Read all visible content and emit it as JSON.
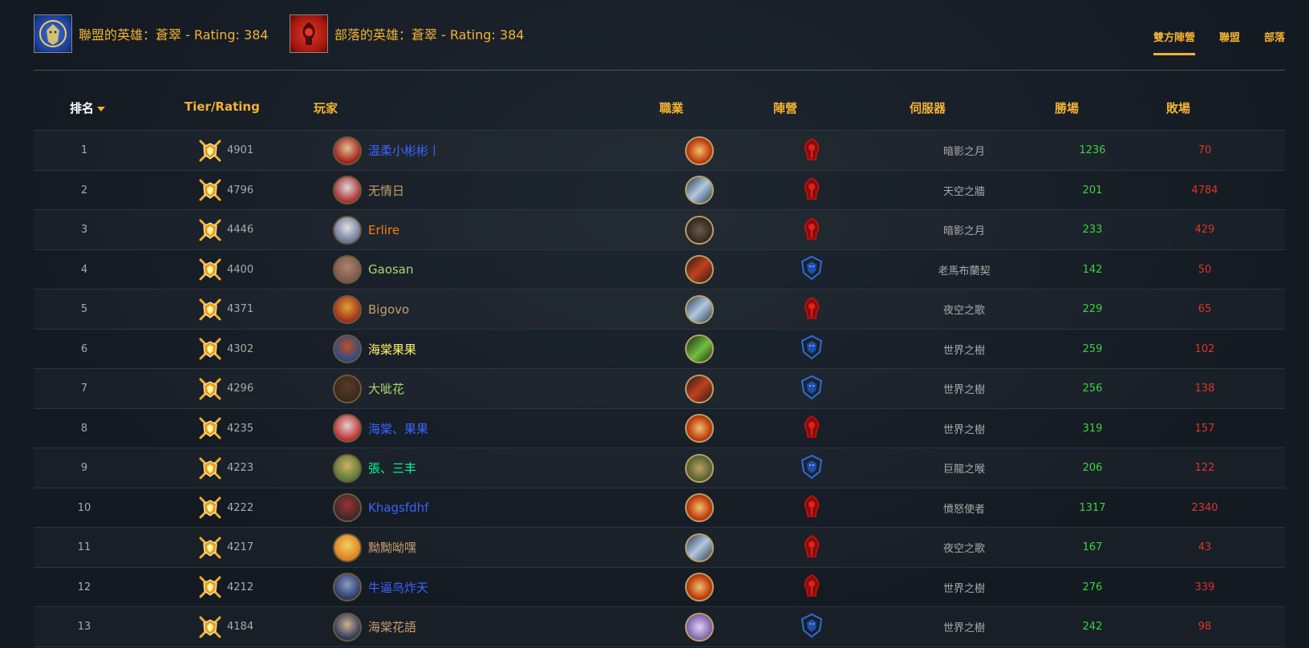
{
  "header": {
    "alliance_hero": "聯盟的英雄：蒼翠 - Rating: 384",
    "horde_hero": "部落的英雄：蒼翠 - Rating: 384",
    "tabs": [
      {
        "label": "雙方陣營",
        "active": true
      },
      {
        "label": "聯盟",
        "active": false
      },
      {
        "label": "部落",
        "active": false
      }
    ]
  },
  "columns": {
    "rank": "排名",
    "tier": "Tier/Rating",
    "player": "玩家",
    "class": "職業",
    "faction": "陣營",
    "server": "伺服器",
    "wins": "勝場",
    "losses": "敗場"
  },
  "colors": {
    "accent": "#f2b233",
    "wins": "#3fd13f",
    "losses": "#d9362a",
    "horde": "#c8120f",
    "alliance": "#2a6fd8"
  },
  "rows": [
    {
      "rank": "1",
      "rating": "4901",
      "name": "温柔小彬彬丨",
      "name_color": "#3a63ff",
      "avatar": [
        "#a02020",
        "#e0c090"
      ],
      "class": "paladin",
      "faction": "horde",
      "server": "暗影之月",
      "wins": "1236",
      "losses": "70"
    },
    {
      "rank": "2",
      "rating": "4796",
      "name": "无情日",
      "name_color": "#c79c6e",
      "avatar": [
        "#b03030",
        "#d8d8d8"
      ],
      "class": "warrior",
      "faction": "horde",
      "server": "天空之牆",
      "wins": "201",
      "losses": "4784"
    },
    {
      "rank": "3",
      "rating": "4446",
      "name": "Erlire",
      "name_color": "#ff7d0a",
      "avatar": [
        "#6a7a9a",
        "#e0e0e0"
      ],
      "class": "rogue",
      "faction": "horde",
      "server": "暗影之月",
      "wins": "233",
      "losses": "429"
    },
    {
      "rank": "4",
      "rating": "4400",
      "name": "Gaosan",
      "name_color": "#abd473",
      "avatar": [
        "#7a5a4a",
        "#b08070"
      ],
      "class": "hunter",
      "faction": "alliance",
      "server": "老馬布蘭契",
      "wins": "142",
      "losses": "50"
    },
    {
      "rank": "5",
      "rating": "4371",
      "name": "Bigovo",
      "name_color": "#c79c6e",
      "avatar": [
        "#a03020",
        "#e0a030"
      ],
      "class": "warrior",
      "faction": "horde",
      "server": "夜空之歌",
      "wins": "229",
      "losses": "65"
    },
    {
      "rank": "6",
      "rating": "4302",
      "name": "海棠果果",
      "name_color": "#fff569",
      "avatar": [
        "#2a4a8a",
        "#c05020"
      ],
      "class": "druid",
      "faction": "alliance",
      "server": "世界之樹",
      "wins": "259",
      "losses": "102"
    },
    {
      "rank": "7",
      "rating": "4296",
      "name": "大呲花",
      "name_color": "#abd473",
      "avatar": [
        "#3a2a1a",
        "#5a3a2a"
      ],
      "class": "hunter",
      "faction": "alliance",
      "server": "世界之樹",
      "wins": "256",
      "losses": "138"
    },
    {
      "rank": "8",
      "rating": "4235",
      "name": "海棠、果果",
      "name_color": "#3a63ff",
      "avatar": [
        "#c03030",
        "#e0d0d0"
      ],
      "class": "paladin",
      "faction": "horde",
      "server": "世界之樹",
      "wins": "319",
      "losses": "157"
    },
    {
      "rank": "9",
      "rating": "4223",
      "name": "張、三丰",
      "name_color": "#00ff96",
      "avatar": [
        "#5a7a3a",
        "#d0b060"
      ],
      "class": "monk",
      "faction": "alliance",
      "server": "巨龍之喉",
      "wins": "206",
      "losses": "122"
    },
    {
      "rank": "10",
      "rating": "4222",
      "name": "Khagsfdhf",
      "name_color": "#3a63ff",
      "avatar": [
        "#3a2a2a",
        "#a03030"
      ],
      "class": "paladin",
      "faction": "horde",
      "server": "憤怒使者",
      "wins": "1317",
      "losses": "2340"
    },
    {
      "rank": "11",
      "rating": "4217",
      "name": "黝黝呦嘿",
      "name_color": "#c79c6e",
      "avatar": [
        "#e08020",
        "#f0d060"
      ],
      "class": "warrior",
      "faction": "horde",
      "server": "夜空之歌",
      "wins": "167",
      "losses": "43"
    },
    {
      "rank": "12",
      "rating": "4212",
      "name": "牛逼鸟炸天",
      "name_color": "#3a63ff",
      "avatar": [
        "#2a3a6a",
        "#8a9ac0"
      ],
      "class": "paladin",
      "faction": "horde",
      "server": "世界之樹",
      "wins": "276",
      "losses": "339"
    },
    {
      "rank": "13",
      "rating": "4184",
      "name": "海棠花語",
      "name_color": "#c79c6e",
      "avatar": [
        "#2a3a5a",
        "#d0b090"
      ],
      "class": "priest",
      "faction": "alliance",
      "server": "世界之樹",
      "wins": "242",
      "losses": "98"
    }
  ]
}
